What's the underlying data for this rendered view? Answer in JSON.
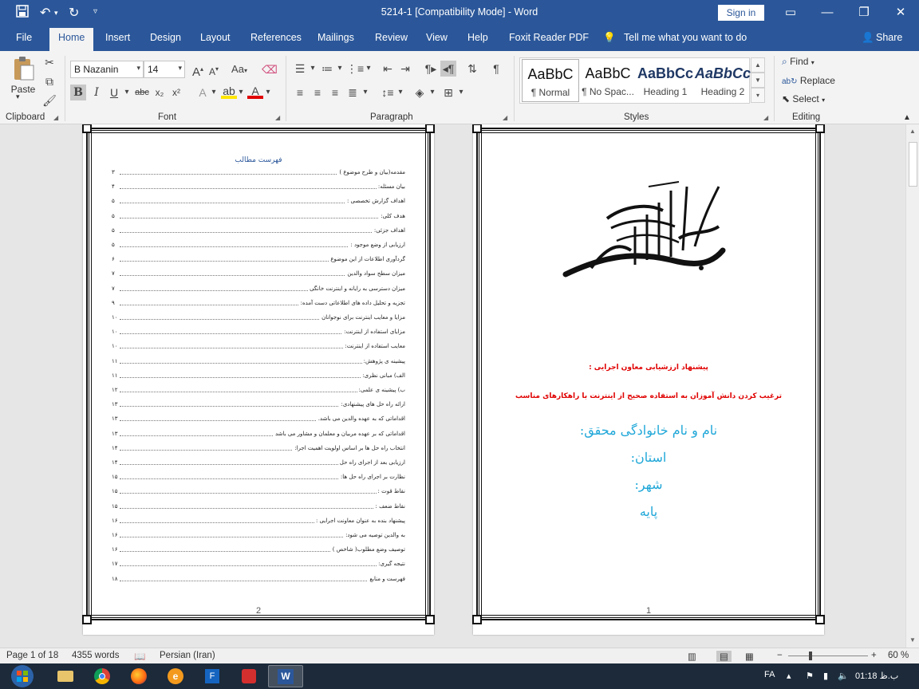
{
  "titlebar": {
    "title": "5214-1 [Compatibility Mode]  -  Word",
    "sign_in": "Sign in"
  },
  "tabs": [
    "File",
    "Home",
    "Insert",
    "Design",
    "Layout",
    "References",
    "Mailings",
    "Review",
    "View",
    "Help",
    "Foxit Reader PDF"
  ],
  "tell_me": "Tell me what you want to do",
  "share": "Share",
  "clipboard": {
    "paste": "Paste",
    "label": "Clipboard"
  },
  "font": {
    "name": "B Nazanin",
    "size": "14",
    "label": "Font",
    "bold": "B",
    "italic": "I",
    "underline": "U",
    "strike": "abc",
    "sub": "x₂",
    "sup": "x²",
    "case": "Aa"
  },
  "paragraph": {
    "label": "Paragraph"
  },
  "styles": {
    "label": "Styles",
    "items": [
      {
        "sample": "AaBbC",
        "name": "¶ Normal"
      },
      {
        "sample": "AaBbC",
        "name": "¶ No Spac..."
      },
      {
        "sample": "AaBbCc",
        "name": "Heading 1"
      },
      {
        "sample": "AaBbCc",
        "name": "Heading 2"
      }
    ]
  },
  "editing": {
    "label": "Editing",
    "find": "Find",
    "replace": "Replace",
    "select": "Select"
  },
  "toc_page": {
    "title": "فهرست مطالب",
    "page_number": "2",
    "entries": [
      {
        "text": "مقدمه(بیان و طرح موضوع )",
        "page": "۳"
      },
      {
        "text": "بیان مسئله:",
        "page": "۴"
      },
      {
        "text": "اهداف گزارش تخصصی :",
        "page": "۵"
      },
      {
        "text": "هدف کلی:",
        "page": "۵"
      },
      {
        "text": "اهداف جزئی:",
        "page": "۵"
      },
      {
        "text": "ارزیابی از وضع موجود :",
        "page": "۵"
      },
      {
        "text": "گردآوری اطلاعات از این موضوع",
        "page": "۶"
      },
      {
        "text": "میزان سطح سواد والدین",
        "page": "۷"
      },
      {
        "text": "میزان دسترسی به رایانه و اینترنت خانگی",
        "page": "۷"
      },
      {
        "text": "تجزیه و تحلیل داده های اطلاعاتی دست آمده:",
        "page": "۹"
      },
      {
        "text": "مزایا و معایب اینترنت برای نوجوانان",
        "page": "۱۰"
      },
      {
        "text": "مزایای استفاده از اینترنت:",
        "page": "۱۰"
      },
      {
        "text": "معایب استفاده از اینترنت:",
        "page": "۱۰"
      },
      {
        "text": "پیشینه ی پژوهش:",
        "page": "۱۱"
      },
      {
        "text": "الف) مبانی نظری:",
        "page": "۱۱"
      },
      {
        "text": "ب) پیشینه ی علمی:",
        "page": "۱۲"
      },
      {
        "text": "ارائه راه حل های پیشنهادی:",
        "page": "۱۳"
      },
      {
        "text": "اقداماتی که به عهده والدین می باشد.",
        "page": "۱۳"
      },
      {
        "text": "اقداماتی که بر عهده مربیان و معلمان و مشاور می باشد",
        "page": "۱۳"
      },
      {
        "text": "انتخاب راه حل ها بر اساس اولویت اهمیت اجرا:",
        "page": "۱۴"
      },
      {
        "text": "ارزیابی بعد از اجرای راه حل",
        "page": "۱۴"
      },
      {
        "text": "نظارت بر اجرای راه حل ها:",
        "page": "۱۵"
      },
      {
        "text": "نقاط قوت :",
        "page": "۱۵"
      },
      {
        "text": "نقاط ضعف :",
        "page": "۱۵"
      },
      {
        "text": "پیشنهاد بنده به عنوان معاونت اجرایی :",
        "page": "۱۶"
      },
      {
        "text": "به والدین توصیه می شود:",
        "page": "۱۶"
      },
      {
        "text": "توصیف وضع مطلوب( شاخص )",
        "page": "۱۶"
      },
      {
        "text": "نتیجه گیری:",
        "page": "۱۷"
      },
      {
        "text": "فهرست و منابع",
        "page": "۱۸"
      }
    ]
  },
  "cover_page": {
    "red1": "پیشنهاد ارزشیابی معاون اجرایی :",
    "red2": "ترغیب کردن دانش آموزان به استفاده صحیح از اینترنت با راهکارهای مناسب",
    "blue": [
      "نام و نام خانوادگی محقق:",
      "استان:",
      "شهر:",
      "پایه"
    ],
    "page_number": "1"
  },
  "status": {
    "page": "Page 1 of 18",
    "words": "4355 words",
    "language": "Persian (Iran)",
    "zoom": "60 %"
  },
  "taskbar": {
    "lang": "FA",
    "time": "01:18 ب.ظ"
  },
  "colors": {
    "word_blue": "#2b579a",
    "red_text": "#e00000",
    "cyan_text": "#1fa7d8"
  }
}
